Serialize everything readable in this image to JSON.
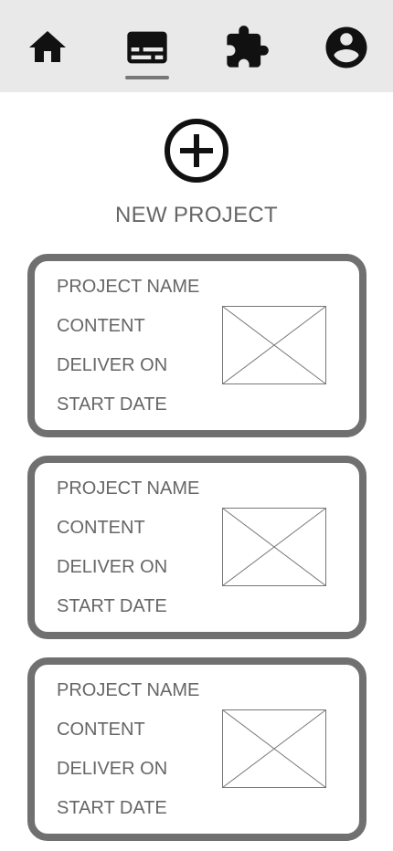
{
  "nav": {
    "items": [
      {
        "icon": "home-icon",
        "active": false
      },
      {
        "icon": "subtitles-icon",
        "active": true
      },
      {
        "icon": "puzzle-icon",
        "active": false
      },
      {
        "icon": "account-circle-icon",
        "active": false
      }
    ]
  },
  "new_project": {
    "icon": "plus-circle-icon",
    "label": "NEW PROJECT"
  },
  "projects": [
    {
      "name": "PROJECT NAME",
      "content": "CONTENT",
      "deliver_on": "DELIVER ON",
      "start_date": "START DATE",
      "image": "image-placeholder-icon"
    },
    {
      "name": "PROJECT NAME",
      "content": "CONTENT",
      "deliver_on": "DELIVER ON",
      "start_date": "START DATE",
      "image": "image-placeholder-icon"
    },
    {
      "name": "PROJECT NAME",
      "content": "CONTENT",
      "deliver_on": "DELIVER ON",
      "start_date": "START DATE",
      "image": "image-placeholder-icon"
    }
  ],
  "colors": {
    "nav_background": "#e9e9e9",
    "card_border": "#707070",
    "text": "#666666",
    "icon": "#111111"
  }
}
